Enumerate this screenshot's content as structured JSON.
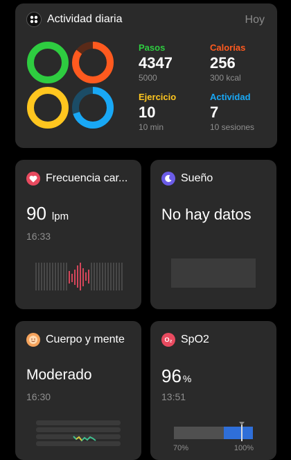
{
  "activity": {
    "title": "Actividad diaria",
    "date_label": "Hoy",
    "rings_colors": [
      "#2ecc40",
      "#ff5a1f",
      "#ffc61f",
      "#19a8f5"
    ],
    "stats": [
      {
        "label": "Pasos",
        "value": "4347",
        "goal": "5000",
        "color": "#2ecc40",
        "progress": 0.87
      },
      {
        "label": "Calorías",
        "value": "256",
        "goal": "300 kcal",
        "color": "#ff5a1f",
        "progress": 0.85
      },
      {
        "label": "Ejercicio",
        "value": "10",
        "goal": "10 min",
        "color": "#ffc61f",
        "progress": 1.0
      },
      {
        "label": "Actividad",
        "value": "7",
        "goal": "10 sesiones",
        "color": "#19a8f5",
        "progress": 0.7
      }
    ]
  },
  "heart": {
    "title": "Frecuencia car...",
    "value": "90",
    "unit": "lpm",
    "time": "16:33",
    "icon": "heart-icon",
    "color": "#e84a5f"
  },
  "sleep": {
    "title": "Sueño",
    "value": "No hay datos",
    "icon": "moon-icon",
    "color": "#6b5ce7"
  },
  "mind": {
    "title": "Cuerpo y mente",
    "value": "Moderado",
    "time": "16:30",
    "icon": "smiley-icon",
    "color": "#f5a35c"
  },
  "spo2": {
    "title": "SpO2",
    "value": "96",
    "unit": "%",
    "time": "13:51",
    "min_label": "70%",
    "max_label": "100%",
    "level": 96,
    "icon": "o2-icon",
    "color": "#e84a5f"
  }
}
